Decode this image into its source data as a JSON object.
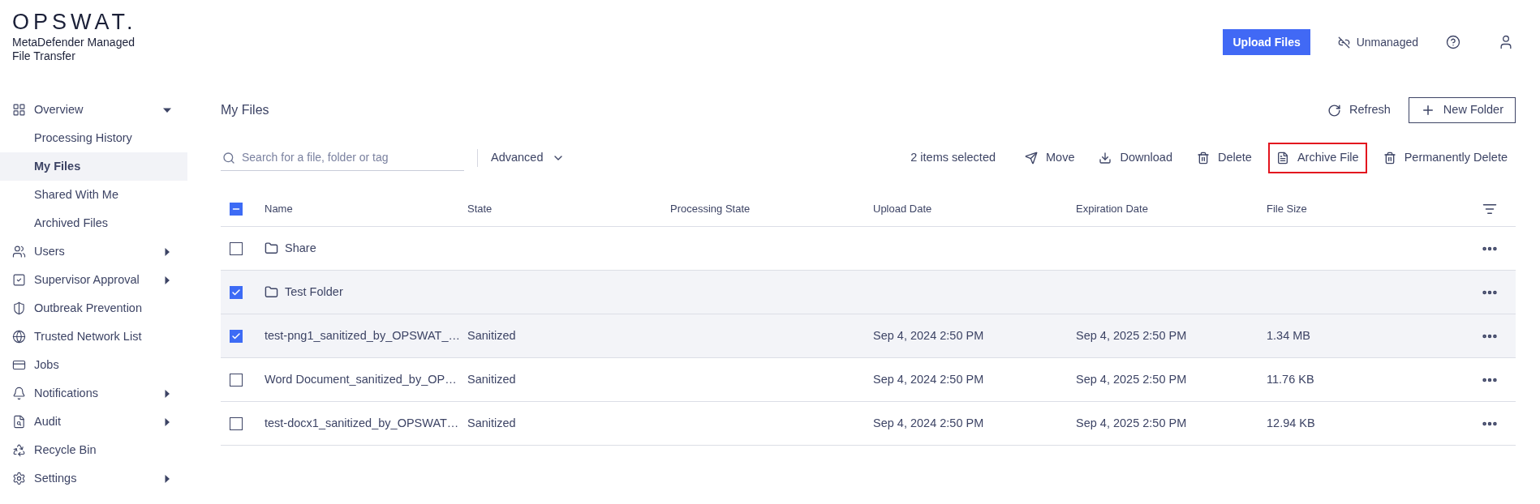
{
  "brand": {
    "logo": "OPSWAT.",
    "product": "MetaDefender Managed File Transfer"
  },
  "sidebar": {
    "items": [
      {
        "kind": "grid",
        "label": "Overview",
        "expanded": true,
        "children": [
          {
            "label": "Processing History",
            "selected": false
          },
          {
            "label": "My Files",
            "selected": true
          },
          {
            "label": "Shared With Me",
            "selected": false
          },
          {
            "label": "Archived Files",
            "selected": false
          }
        ]
      },
      {
        "kind": "users",
        "label": "Users",
        "expanded": false
      },
      {
        "kind": "approval",
        "label": "Supervisor Approval",
        "expanded": false
      },
      {
        "kind": "shield",
        "label": "Outbreak Prevention"
      },
      {
        "kind": "globe",
        "label": "Trusted Network List"
      },
      {
        "kind": "window",
        "label": "Jobs"
      },
      {
        "kind": "bell",
        "label": "Notifications",
        "expanded": false
      },
      {
        "kind": "audit",
        "label": "Audit",
        "expanded": false
      },
      {
        "kind": "recycle",
        "label": "Recycle Bin"
      },
      {
        "kind": "settings",
        "label": "Settings",
        "expanded": false
      }
    ]
  },
  "header": {
    "upload_button": "Upload Files",
    "mode": "Unmanaged"
  },
  "page": {
    "title": "My Files",
    "refresh": "Refresh",
    "new_folder": "New Folder"
  },
  "toolbar": {
    "search": {
      "placeholder": "Search for a file, folder or tag"
    },
    "advanced": "Advanced",
    "selection_count": "2 items selected",
    "actions": [
      {
        "kind": "move",
        "label": "Move",
        "highlighted": false
      },
      {
        "kind": "download",
        "label": "Download",
        "highlighted": false
      },
      {
        "kind": "delete",
        "label": "Delete",
        "highlighted": false
      },
      {
        "kind": "archive",
        "label": "Archive File",
        "highlighted": true
      },
      {
        "kind": "delete",
        "label": "Permanently Delete",
        "highlighted": false
      }
    ]
  },
  "table": {
    "select_all": {
      "indeterminate": true
    },
    "columns": [
      "Name",
      "State",
      "Processing State",
      "Upload Date",
      "Expiration Date",
      "File Size"
    ],
    "rows": [
      {
        "kind": "folder",
        "selected": false,
        "name": "Share"
      },
      {
        "kind": "folder",
        "selected": true,
        "name": "Test Folder"
      },
      {
        "kind": "file",
        "selected": true,
        "name": "test-png1_sanitized_by_OPSWAT_…",
        "state": "Sanitized",
        "upload_date": "Sep 4, 2024 2:50 PM",
        "expiration_date": "Sep 4, 2025 2:50 PM",
        "file_size": "1.34 MB"
      },
      {
        "kind": "file",
        "selected": false,
        "name": "Word Document_sanitized_by_OP…",
        "state": "Sanitized",
        "upload_date": "Sep 4, 2024 2:50 PM",
        "expiration_date": "Sep 4, 2025 2:50 PM",
        "file_size": "11.76 KB"
      },
      {
        "kind": "file",
        "selected": false,
        "name": "test-docx1_sanitized_by_OPSWAT…",
        "state": "Sanitized",
        "upload_date": "Sep 4, 2024 2:50 PM",
        "expiration_date": "Sep 4, 2025 2:50 PM",
        "file_size": "12.94 KB"
      }
    ]
  }
}
